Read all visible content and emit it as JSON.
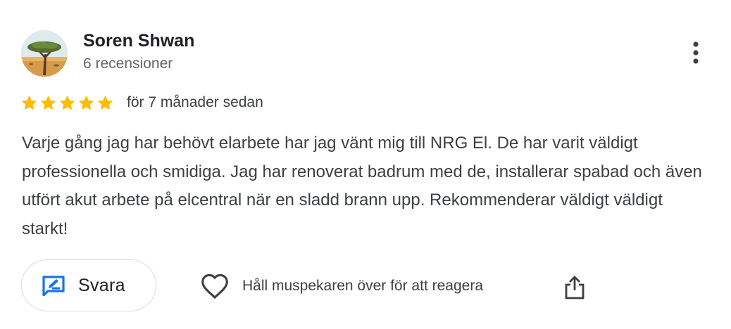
{
  "review": {
    "author_name": "Soren Shwan",
    "review_count": "6 recensioner",
    "rating": 5,
    "rating_max": 5,
    "date": "för 7 månader sedan",
    "text": "Varje gång jag har behövt elarbete har jag vänt mig till NRG El. De har varit väldigt professionella och smidiga. Jag har renoverat badrum med de, installerar spabad och även utfört akut arbete på elcentral när en sladd brann upp. Rekommenderar väldigt väldigt starkt!"
  },
  "actions": {
    "reply_label": "Svara",
    "react_label": "Håll muspekaren över för att reagera"
  },
  "icons": {
    "avatar": "acacia-tree-avatar",
    "more": "more-vertical-icon",
    "star": "star-icon",
    "reply": "reply-edit-icon",
    "react": "heart-icon",
    "share": "share-icon"
  },
  "colors": {
    "star": "#fbbc04",
    "accent": "#1a73e8",
    "text_primary": "#202124",
    "text_secondary": "#5f6368",
    "border": "#dadce0"
  }
}
